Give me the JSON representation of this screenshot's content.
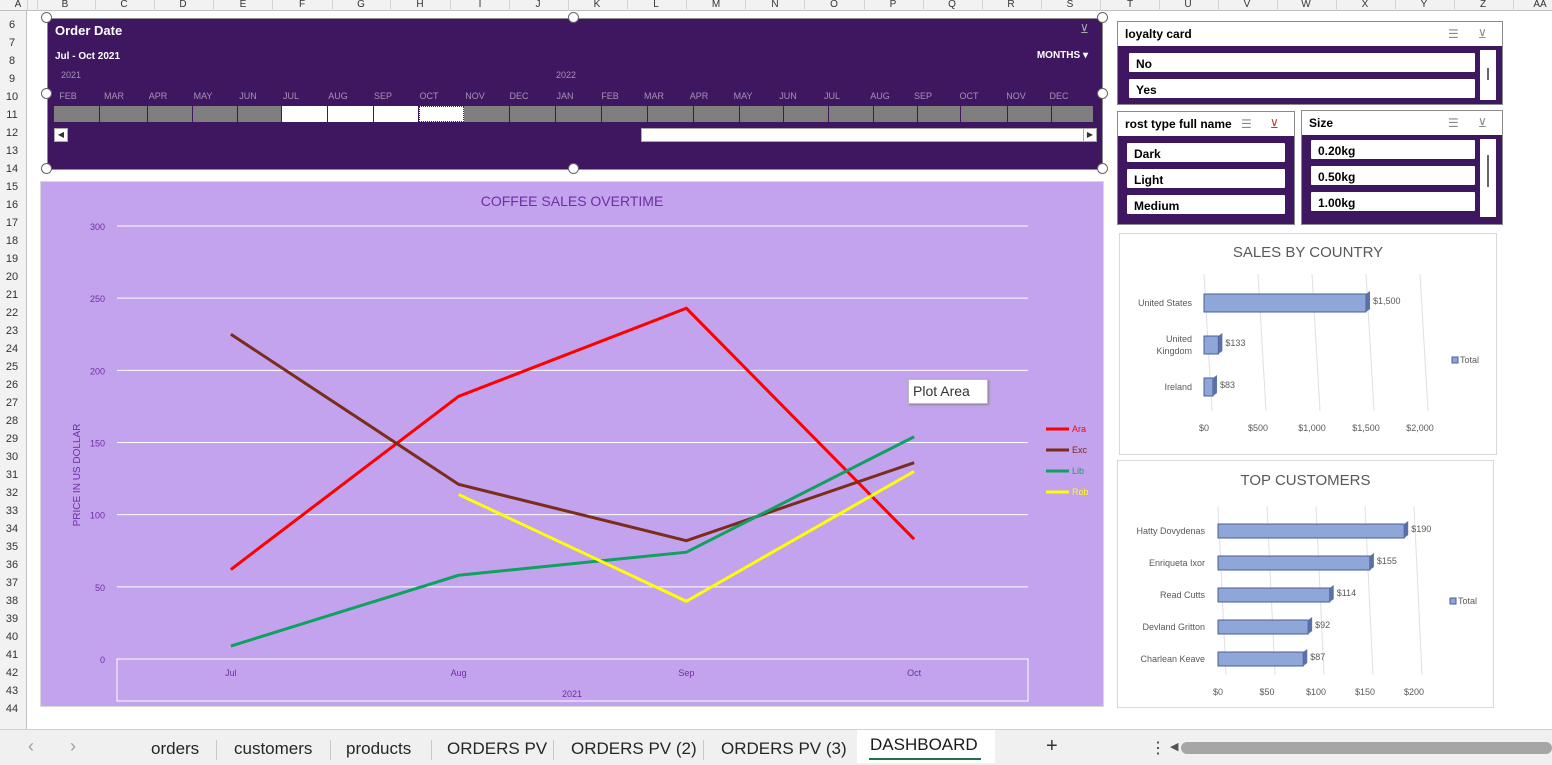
{
  "columns": [
    "A",
    "B",
    "C",
    "D",
    "E",
    "F",
    "G",
    "H",
    "I",
    "J",
    "K",
    "L",
    "M",
    "N",
    "O",
    "P",
    "Q",
    "R",
    "S",
    "T",
    "U",
    "V",
    "W",
    "X",
    "Y",
    "Z",
    "AA"
  ],
  "rows": [
    "6",
    "7",
    "8",
    "9",
    "10",
    "11",
    "12",
    "13",
    "14",
    "15",
    "16",
    "17",
    "18",
    "19",
    "20",
    "21",
    "22",
    "23",
    "24",
    "25",
    "26",
    "27",
    "28",
    "29",
    "30",
    "31",
    "32",
    "33",
    "34",
    "35",
    "36",
    "37",
    "38",
    "39",
    "40",
    "41",
    "42",
    "43",
    "44"
  ],
  "timeline": {
    "title": "Order Date",
    "range": "Jul - Oct 2021",
    "period": "MONTHS",
    "years": [
      "2021",
      "2022"
    ],
    "months": [
      "FEB",
      "MAR",
      "APR",
      "MAY",
      "JUN",
      "JUL",
      "AUG",
      "SEP",
      "OCT",
      "NOV",
      "DEC",
      "JAN",
      "FEB",
      "MAR",
      "APR",
      "MAY",
      "JUN",
      "JUL",
      "AUG",
      "SEP",
      "OCT",
      "NOV",
      "DEC"
    ],
    "selected": [
      "JUL",
      "AUG",
      "SEP",
      "OCT"
    ]
  },
  "chart_data": {
    "type": "line",
    "title": "COFFEE SALES OVERTIME",
    "ylabel": "PRICE IN US DOLLAR",
    "xlabel": "2021",
    "categories": [
      "Jul",
      "Aug",
      "Sep",
      "Oct"
    ],
    "ylim": [
      0,
      300
    ],
    "yticks": [
      0,
      50,
      100,
      150,
      200,
      250,
      300
    ],
    "grid": true,
    "legend_position": "right",
    "series": [
      {
        "name": "Ara",
        "color": "#ff0000",
        "values": [
          62,
          182,
          243,
          83
        ]
      },
      {
        "name": "Exc",
        "color": "#7b2c1a",
        "values": [
          225,
          121,
          82,
          136
        ]
      },
      {
        "name": "Lib",
        "color": "#10a060",
        "values": [
          9,
          58,
          74,
          154
        ]
      },
      {
        "name": "Rob",
        "color": "#ffff00",
        "values": [
          null,
          114,
          40,
          130
        ]
      }
    ]
  },
  "tooltip": "Plot Area",
  "slicers": {
    "loyalty": {
      "title": "loyalty card",
      "items": [
        "No",
        "Yes"
      ]
    },
    "roast": {
      "title": "rost type full name",
      "items": [
        "Dark",
        "Light",
        "Medium"
      ]
    },
    "size": {
      "title": "Size",
      "items": [
        "0.20kg",
        "0.50kg",
        "1.00kg"
      ]
    }
  },
  "sales_by_country": {
    "title": "SALES BY COUNTRY",
    "legend": "Total",
    "categories": [
      "United States",
      "United Kingdom",
      "Ireland"
    ],
    "values": [
      1500,
      133,
      83
    ],
    "labels": [
      "$1,500",
      "$133",
      "$83"
    ],
    "xticks": [
      "$0",
      "$500",
      "$1,000",
      "$1,500",
      "$2,000"
    ]
  },
  "top_customers": {
    "title": "TOP CUSTOMERS",
    "legend": "Total",
    "categories": [
      "Hatty Dovydenas",
      "Enriqueta Ixor",
      "Read Cutts",
      "Devland Gritton",
      "Charlean Keave"
    ],
    "values": [
      190,
      155,
      114,
      92,
      87
    ],
    "labels": [
      "$190",
      "$155",
      "$114",
      "$92",
      "$87"
    ],
    "xticks": [
      "$0",
      "$50",
      "$100",
      "$150",
      "$200"
    ]
  },
  "sheet_tabs": [
    "orders",
    "customers",
    "products",
    "ORDERS PV",
    "ORDERS PV (2)",
    "ORDERS PV (3)",
    "DASHBOARD"
  ],
  "active_tab": "DASHBOARD",
  "colors": {
    "timeline_bg": "#3f1761",
    "chart_bg": "#c3a2ee",
    "bar_fill": "#8fa6d8",
    "tab_accent": "#217346"
  }
}
